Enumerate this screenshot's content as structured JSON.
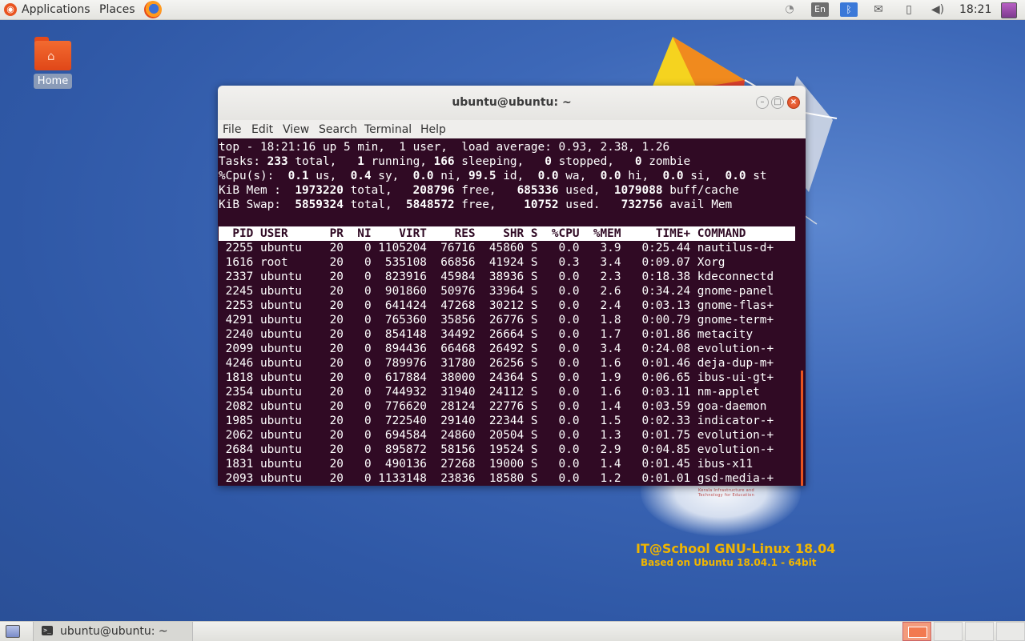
{
  "top_panel": {
    "applications_label": "Applications",
    "places_label": "Places",
    "language_indicator": "En",
    "clock": "18:21",
    "icons": [
      "ubuntu-logo-icon",
      "firefox-icon",
      "wifi-icon",
      "bluetooth-icon",
      "mail-icon",
      "battery-icon",
      "volume-icon",
      "power-icon"
    ]
  },
  "desktop": {
    "home_label": "Home",
    "os_title": "IT@School GNU-Linux 18.04",
    "os_subtitle": "Based on Ubuntu 18.04.1 - 64bit",
    "logo_text": "Kerala Infrastructure and Technology for Education"
  },
  "terminal": {
    "title": "ubuntu@ubuntu: ~",
    "menu": [
      "File",
      "Edit",
      "View",
      "Search",
      "Terminal",
      "Help"
    ],
    "summary": {
      "line1": "top - 18:21:16 up 5 min,  1 user,  load average: 0.93, 2.38, 1.26",
      "tasks": {
        "total": "233",
        "running": "1",
        "sleeping": "166",
        "stopped": "0",
        "zombie": "0"
      },
      "cpu": {
        "us": "0.1",
        "sy": "0.4",
        "ni": "0.0",
        "id": "99.5",
        "wa": "0.0",
        "hi": "0.0",
        "si": "0.0",
        "st": ""
      },
      "mem": {
        "total": "1973220",
        "free": "208796",
        "used": "685336",
        "buff_cache": "1079088"
      },
      "swap": {
        "total": "5859324",
        "free": "5848572",
        "used": "10752",
        "avail_mem": "732756"
      }
    },
    "columns": [
      "PID",
      "USER",
      "PR",
      "NI",
      "VIRT",
      "RES",
      "SHR",
      "S",
      "%CPU",
      "%MEM",
      "TIME+",
      "COMMAND"
    ],
    "processes": [
      [
        "2255",
        "ubuntu",
        "20",
        "0",
        "1105204",
        "76716",
        "45860",
        "S",
        "0.0",
        "3.9",
        "0:25.44",
        "nautilus-d+"
      ],
      [
        "1616",
        "root",
        "20",
        "0",
        "535108",
        "66856",
        "41924",
        "S",
        "0.3",
        "3.4",
        "0:09.07",
        "Xorg"
      ],
      [
        "2337",
        "ubuntu",
        "20",
        "0",
        "823916",
        "45984",
        "38936",
        "S",
        "0.0",
        "2.3",
        "0:18.38",
        "kdeconnectd"
      ],
      [
        "2245",
        "ubuntu",
        "20",
        "0",
        "901860",
        "50976",
        "33964",
        "S",
        "0.0",
        "2.6",
        "0:34.24",
        "gnome-panel"
      ],
      [
        "2253",
        "ubuntu",
        "20",
        "0",
        "641424",
        "47268",
        "30212",
        "S",
        "0.0",
        "2.4",
        "0:03.13",
        "gnome-flas+"
      ],
      [
        "4291",
        "ubuntu",
        "20",
        "0",
        "765360",
        "35856",
        "26776",
        "S",
        "0.0",
        "1.8",
        "0:00.79",
        "gnome-term+"
      ],
      [
        "2240",
        "ubuntu",
        "20",
        "0",
        "854148",
        "34492",
        "26664",
        "S",
        "0.0",
        "1.7",
        "0:01.86",
        "metacity"
      ],
      [
        "2099",
        "ubuntu",
        "20",
        "0",
        "894436",
        "66468",
        "26492",
        "S",
        "0.0",
        "3.4",
        "0:24.08",
        "evolution-+"
      ],
      [
        "4246",
        "ubuntu",
        "20",
        "0",
        "789976",
        "31780",
        "26256",
        "S",
        "0.0",
        "1.6",
        "0:01.46",
        "deja-dup-m+"
      ],
      [
        "1818",
        "ubuntu",
        "20",
        "0",
        "617884",
        "38000",
        "24364",
        "S",
        "0.0",
        "1.9",
        "0:06.65",
        "ibus-ui-gt+"
      ],
      [
        "2354",
        "ubuntu",
        "20",
        "0",
        "744932",
        "31940",
        "24112",
        "S",
        "0.0",
        "1.6",
        "0:03.11",
        "nm-applet"
      ],
      [
        "2082",
        "ubuntu",
        "20",
        "0",
        "776620",
        "28124",
        "22776",
        "S",
        "0.0",
        "1.4",
        "0:03.59",
        "goa-daemon"
      ],
      [
        "1985",
        "ubuntu",
        "20",
        "0",
        "722540",
        "29140",
        "22344",
        "S",
        "0.0",
        "1.5",
        "0:02.33",
        "indicator-+"
      ],
      [
        "2062",
        "ubuntu",
        "20",
        "0",
        "694584",
        "24860",
        "20504",
        "S",
        "0.0",
        "1.3",
        "0:01.75",
        "evolution-+"
      ],
      [
        "2684",
        "ubuntu",
        "20",
        "0",
        "895872",
        "58156",
        "19524",
        "S",
        "0.0",
        "2.9",
        "0:04.85",
        "evolution-+"
      ],
      [
        "1831",
        "ubuntu",
        "20",
        "0",
        "490136",
        "27268",
        "19000",
        "S",
        "0.0",
        "1.4",
        "0:01.45",
        "ibus-x11"
      ],
      [
        "2093",
        "ubuntu",
        "20",
        "0",
        "1133148",
        "23836",
        "18580",
        "S",
        "0.0",
        "1.2",
        "0:01.01",
        "gsd-media-+"
      ]
    ]
  },
  "taskbar": {
    "window_label": "ubuntu@ubuntu: ~"
  },
  "colors": {
    "terminal_bg": "#300a24",
    "accent": "#e95420",
    "desktop_bg": "#3f6ab9"
  }
}
